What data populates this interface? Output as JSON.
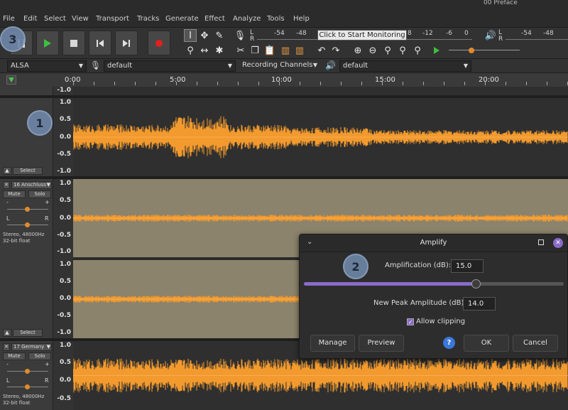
{
  "window": {
    "title": "00 Preface"
  },
  "menu": [
    "File",
    "Edit",
    "Select",
    "View",
    "Transport",
    "Tracks",
    "Generate",
    "Effect",
    "Analyze",
    "Tools",
    "Help"
  ],
  "toolbar": {
    "monitor_label": "Click to Start Monitoring",
    "rec_meter_ticks": [
      "-54",
      "-48",
      "8",
      "-12",
      "-6",
      "0"
    ],
    "play_meter_ticks": [
      "-54",
      "-48"
    ],
    "lr": {
      "l": "L",
      "r": "R"
    }
  },
  "device_bar": {
    "host": "ALSA",
    "rec_device": "default",
    "channels": "Recording Channels",
    "play_device": "default"
  },
  "timeline": {
    "labels": [
      "0:00",
      "5:00",
      "10:00",
      "15:00",
      "20:00"
    ]
  },
  "scale": {
    "top": "1.0",
    "upper": "0.5",
    "mid": "0.0",
    "lower": "-0.5",
    "bottom": "-1.0",
    "bottom_prev": "-1.0"
  },
  "tracks": [
    {
      "select_label": "Select"
    },
    {
      "name": "16 Anschluss",
      "mute": "Mute",
      "solo": "Solo",
      "gain_minus": "-",
      "gain_plus": "+",
      "pan_l": "L",
      "pan_r": "R",
      "info_line1": "Stereo, 48000Hz",
      "info_line2": "32-bit float",
      "select_label": "Select"
    },
    {
      "name": "17 Germany",
      "mute": "Mute",
      "solo": "Solo",
      "gain_minus": "-",
      "gain_plus": "+",
      "pan_l": "L",
      "pan_r": "R",
      "info_line1": "Stereo, 48000Hz",
      "info_line2": "32-bit float"
    }
  ],
  "badges": {
    "one": "1",
    "two": "2",
    "three": "3"
  },
  "dialog": {
    "title": "Amplify",
    "amplification_label": "Amplification (dB):",
    "amplification_value": "15.0",
    "slider_fraction": 0.66,
    "peak_label": "New Peak Amplitude (dB):",
    "peak_value": "14.0",
    "allow_clipping_label": "Allow clipping",
    "allow_clipping_checked": true,
    "manage_label": "Manage",
    "preview_label": "Preview",
    "help_label": "?",
    "ok_label": "OK",
    "cancel_label": "Cancel"
  },
  "colors": {
    "waveform": "#f29a2e",
    "accent": "#8a6bc8",
    "selection": "#8b836c",
    "badge": "#6e87a8"
  }
}
